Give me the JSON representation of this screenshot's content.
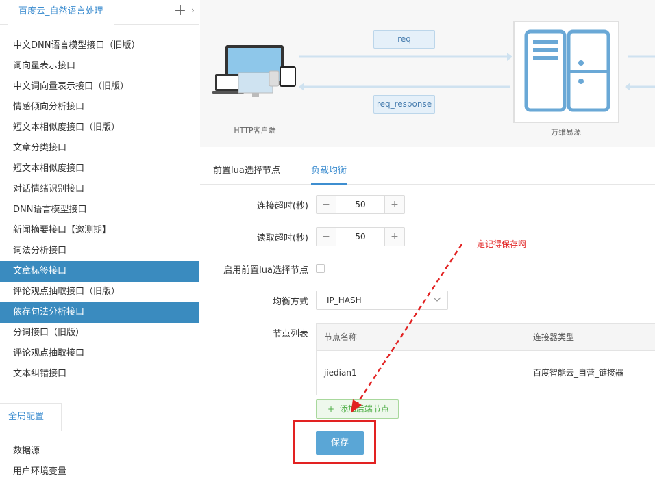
{
  "sidebar": {
    "title": "百度云_自然语言处理",
    "add_icon": "+",
    "expand_icon": "›",
    "items": [
      {
        "label": "中文DNN语言模型接口（旧版）",
        "active": false
      },
      {
        "label": "词向量表示接口",
        "active": false
      },
      {
        "label": "中文词向量表示接口（旧版）",
        "active": false
      },
      {
        "label": "情感倾向分析接口",
        "active": false
      },
      {
        "label": "短文本相似度接口（旧版）",
        "active": false
      },
      {
        "label": "文章分类接口",
        "active": false
      },
      {
        "label": "短文本相似度接口",
        "active": false
      },
      {
        "label": "对话情绪识别接口",
        "active": false
      },
      {
        "label": "DNN语言模型接口",
        "active": false
      },
      {
        "label": "新闻摘要接口【邀测期】",
        "active": false
      },
      {
        "label": "词法分析接口",
        "active": false
      },
      {
        "label": "文章标签接口",
        "active": true
      },
      {
        "label": "评论观点抽取接口（旧版）",
        "active": false
      },
      {
        "label": "依存句法分析接口",
        "active": true
      },
      {
        "label": "分词接口（旧版）",
        "active": false
      },
      {
        "label": "评论观点抽取接口",
        "active": false
      },
      {
        "label": "文本纠错接口",
        "active": false
      }
    ],
    "global_tab": "全局配置",
    "global_items": [
      "数据源",
      "用户环境变量"
    ]
  },
  "diagram": {
    "client_label": "HTTP客户端",
    "server_label": "万维易源",
    "req_label": "req",
    "resp_label": "req_response"
  },
  "tabs": [
    "前置lua选择节点",
    "负载均衡"
  ],
  "active_tab": "负载均衡",
  "form": {
    "connect_timeout_label": "连接超时(秒)",
    "connect_timeout_value": "50",
    "read_timeout_label": "读取超时(秒)",
    "read_timeout_value": "50",
    "enable_lua_label": "启用前置lua选择节点",
    "enable_lua_checked": false,
    "balance_label": "均衡方式",
    "balance_value": "IP_HASH",
    "node_list_label": "节点列表",
    "stepper_minus": "−",
    "stepper_plus": "+"
  },
  "node_table": {
    "columns": [
      "节点名称",
      "连接器类型"
    ],
    "rows": [
      [
        "jiedian1",
        "百度智能云_自营_链接器"
      ]
    ]
  },
  "add_node_label": "添加后端节点",
  "add_node_icon": "+",
  "save_label": "保存",
  "annotation": "一定记得保存啊",
  "colors": {
    "accent": "#3e8ed0",
    "active_bg": "#3a8bbf",
    "annotation": "#e22222",
    "save_bg": "#5aa6d6"
  }
}
